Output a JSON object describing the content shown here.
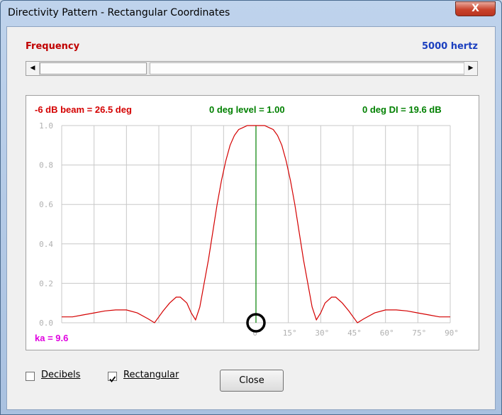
{
  "window": {
    "title": "Directivity Pattern - Rectangular Coordinates",
    "close_glyph": "X"
  },
  "frequency": {
    "label": "Frequency",
    "value_text": "5000 hertz",
    "slider_fraction": 0.0
  },
  "chart_header": {
    "beam": "-6 dB beam = 26.5 deg",
    "level": "0 deg level = 1.00",
    "di": "0 deg DI = 19.6 dB"
  },
  "ka_text": "ka = 9.6",
  "options": {
    "decibels_label": "Decibels",
    "decibels_checked": false,
    "rectangular_label": "Rectangular",
    "rectangular_checked": true
  },
  "close_button": "Close",
  "colors": {
    "curve": "#d40000",
    "axis_marker": "#008000",
    "grid": "#c8c8c8",
    "beam_text": "#d40000",
    "level_text": "#008000",
    "ka_text": "#e000e0"
  },
  "chart_data": {
    "type": "line",
    "title": "",
    "xlabel": "",
    "ylabel": "",
    "xlim": [
      -90,
      90
    ],
    "ylim": [
      0,
      1.0
    ],
    "yticks": [
      "0.0",
      "0.2",
      "0.4",
      "0.6",
      "0.8",
      "1.0"
    ],
    "xticks": [
      "0°",
      "15°",
      "30°",
      "45°",
      "60°",
      "75°",
      "90°"
    ],
    "grid": true,
    "marker_angle": 0,
    "series": [
      {
        "x": [
          -90,
          -85,
          -80,
          -75,
          -70,
          -65,
          -60,
          -55,
          -50,
          -47,
          -45,
          -43,
          -40,
          -37,
          -35,
          -32,
          -30,
          -28,
          -26,
          -24,
          -22,
          -20,
          -18,
          -16,
          -14,
          -12,
          -10,
          -8,
          -6,
          -4,
          -2,
          0,
          2,
          4,
          6,
          8,
          10,
          12,
          14,
          16,
          18,
          20,
          22,
          24,
          26,
          28,
          30,
          32,
          35,
          37,
          40,
          43,
          45,
          47,
          50,
          55,
          60,
          65,
          70,
          75,
          80,
          85,
          90
        ],
        "y": [
          0.03,
          0.03,
          0.04,
          0.05,
          0.06,
          0.065,
          0.065,
          0.05,
          0.02,
          0.0,
          0.03,
          0.06,
          0.1,
          0.13,
          0.13,
          0.1,
          0.05,
          0.015,
          0.08,
          0.2,
          0.32,
          0.46,
          0.6,
          0.72,
          0.82,
          0.9,
          0.95,
          0.98,
          0.99,
          1.0,
          1.0,
          1.0,
          1.0,
          1.0,
          0.99,
          0.98,
          0.95,
          0.9,
          0.82,
          0.72,
          0.6,
          0.46,
          0.32,
          0.2,
          0.08,
          0.015,
          0.05,
          0.1,
          0.13,
          0.13,
          0.1,
          0.06,
          0.03,
          0.0,
          0.02,
          0.05,
          0.065,
          0.065,
          0.06,
          0.05,
          0.04,
          0.03,
          0.03
        ]
      }
    ]
  }
}
